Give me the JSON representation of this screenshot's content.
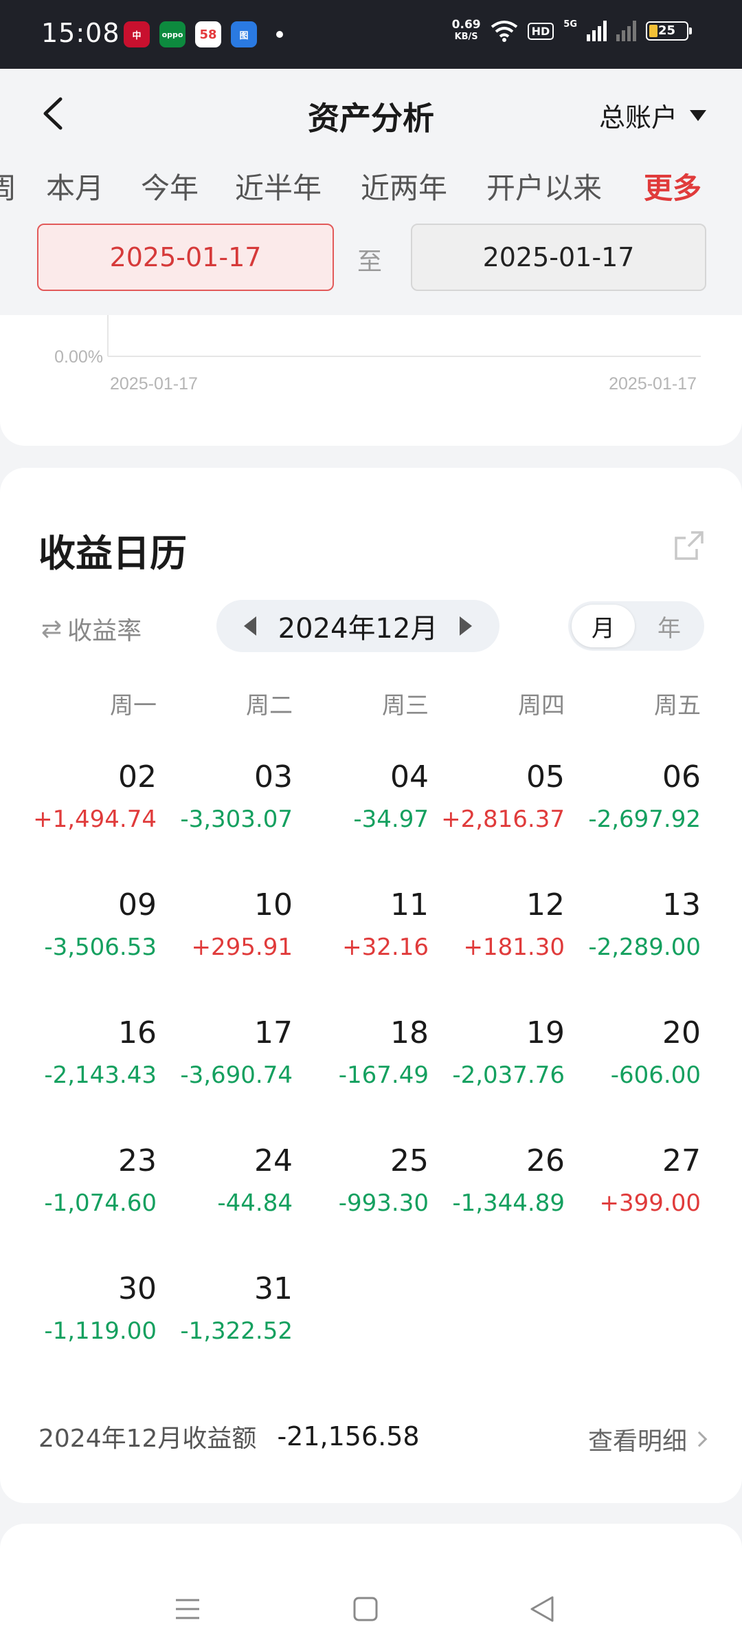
{
  "status_bar": {
    "time": "15:08",
    "apps": [
      {
        "name": "boc-app-icon",
        "label": "中"
      },
      {
        "name": "oppo-app-icon",
        "label": "oppo"
      },
      {
        "name": "app58-icon",
        "label": "58"
      },
      {
        "name": "map-app-icon",
        "label": "图"
      }
    ],
    "net_speed": "0.69",
    "net_unit": "KB/S",
    "hd": "HD",
    "network": "5G",
    "battery": "25"
  },
  "header": {
    "title": "资产分析",
    "account": "总账户",
    "tabs": [
      {
        "label": "周",
        "active": false
      },
      {
        "label": "本月",
        "active": false
      },
      {
        "label": "今年",
        "active": false
      },
      {
        "label": "近半年",
        "active": false
      },
      {
        "label": "近两年",
        "active": false
      },
      {
        "label": "开户以来",
        "active": false
      },
      {
        "label": "更多",
        "active": true
      }
    ],
    "start_date": "2025-01-17",
    "separator": "至",
    "end_date": "2025-01-17"
  },
  "chart": {
    "y_label": "0.00%",
    "x_start": "2025-01-17",
    "x_end": "2025-01-17"
  },
  "calendar": {
    "title": "收益日历",
    "metric_toggle": "收益率",
    "month": "2024年12月",
    "view_month": "月",
    "view_year": "年",
    "weekdays": [
      "周一",
      "周二",
      "周三",
      "周四",
      "周五"
    ],
    "weeks": [
      [
        {
          "day": "02",
          "pnl": "+1,494.74"
        },
        {
          "day": "03",
          "pnl": "-3,303.07"
        },
        {
          "day": "04",
          "pnl": "-34.97"
        },
        {
          "day": "05",
          "pnl": "+2,816.37"
        },
        {
          "day": "06",
          "pnl": "-2,697.92"
        }
      ],
      [
        {
          "day": "09",
          "pnl": "-3,506.53"
        },
        {
          "day": "10",
          "pnl": "+295.91"
        },
        {
          "day": "11",
          "pnl": "+32.16"
        },
        {
          "day": "12",
          "pnl": "+181.30"
        },
        {
          "day": "13",
          "pnl": "-2,289.00"
        }
      ],
      [
        {
          "day": "16",
          "pnl": "-2,143.43"
        },
        {
          "day": "17",
          "pnl": "-3,690.74"
        },
        {
          "day": "18",
          "pnl": "-167.49"
        },
        {
          "day": "19",
          "pnl": "-2,037.76"
        },
        {
          "day": "20",
          "pnl": "-606.00"
        }
      ],
      [
        {
          "day": "23",
          "pnl": "-1,074.60"
        },
        {
          "day": "24",
          "pnl": "-44.84"
        },
        {
          "day": "25",
          "pnl": "-993.30"
        },
        {
          "day": "26",
          "pnl": "-1,344.89"
        },
        {
          "day": "27",
          "pnl": "+399.00"
        }
      ],
      [
        {
          "day": "30",
          "pnl": "-1,119.00"
        },
        {
          "day": "31",
          "pnl": "-1,322.52"
        }
      ]
    ],
    "summary_label": "2024年12月收益额",
    "summary_value": "-21,156.58",
    "detail_link": "查看明细"
  },
  "colors": {
    "gain": "#e03b3b",
    "loss": "#14a05f",
    "accent": "#e03b3b"
  }
}
